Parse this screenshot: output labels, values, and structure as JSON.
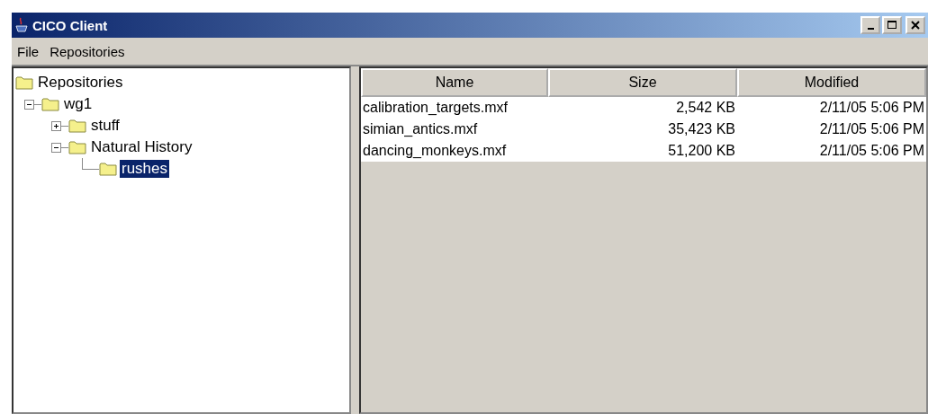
{
  "window": {
    "title": "CICO Client"
  },
  "menu": [
    "File",
    "Repositories"
  ],
  "tree": {
    "label": "Repositories",
    "selected": false,
    "children": [
      {
        "label": "wg1",
        "selected": false,
        "expanded": true,
        "children": [
          {
            "label": "stuff",
            "selected": false,
            "expanded": false
          },
          {
            "label": "Natural History",
            "selected": false,
            "expanded": true,
            "children": [
              {
                "label": "rushes",
                "selected": true
              }
            ]
          }
        ]
      }
    ]
  },
  "table": {
    "columns": [
      "Name",
      "Size",
      "Modified"
    ],
    "rows": [
      [
        "calibration_targets.mxf",
        "2,542 KB",
        "2/11/05 5:06 PM"
      ],
      [
        "simian_antics.mxf",
        "35,423 KB",
        "2/11/05 5:06 PM"
      ],
      [
        "dancing_monkeys.mxf",
        "51,200 KB",
        "2/11/05 5:06 PM"
      ]
    ]
  }
}
